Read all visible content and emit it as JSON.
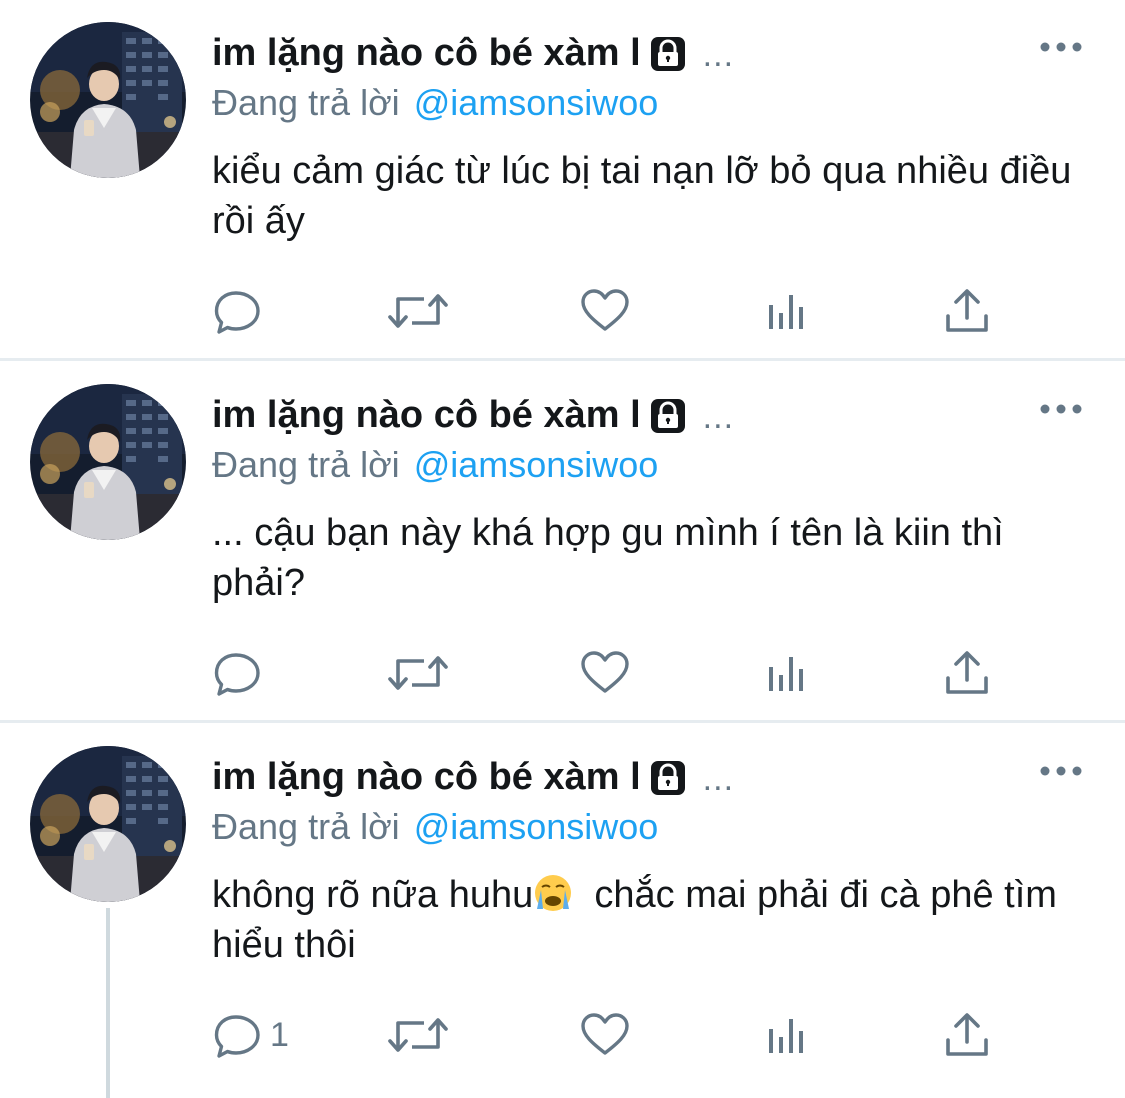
{
  "colors": {
    "text": "#14171a",
    "secondary": "#657786",
    "accent": "#1da1f2",
    "divider": "#e6ecf0",
    "icon": "#657786"
  },
  "tweets": [
    {
      "author": {
        "display_name": "im lặng nào cô bé xàm l",
        "truncation": "...",
        "icon": "lock-icon"
      },
      "reply_prefix": "Đang trả lời",
      "reply_handle": "@iamsonsiwoo",
      "text": "kiểu cảm giác từ lúc bị tai nạn lỡ bỏ qua nhiều điều rồi ấy",
      "emoji": "",
      "text_after_emoji": "",
      "reply_count": ""
    },
    {
      "author": {
        "display_name": "im lặng nào cô bé xàm l",
        "truncation": "...",
        "icon": "lock-icon"
      },
      "reply_prefix": "Đang trả lời",
      "reply_handle": "@iamsonsiwoo",
      "text": "... cậu bạn này khá hợp gu mình í tên là kiin thì phải?",
      "emoji": "",
      "text_after_emoji": "",
      "reply_count": ""
    },
    {
      "author": {
        "display_name": "im lặng nào cô bé xàm l",
        "truncation": "...",
        "icon": "lock-icon"
      },
      "reply_prefix": "Đang trả lời",
      "reply_handle": "@iamsonsiwoo",
      "text": "không rõ nữa huhu",
      "emoji": "loudly-crying-face-icon",
      "text_after_emoji": "  chắc mai phải đi cà phê tìm hiểu thôi",
      "reply_count": "1"
    }
  ]
}
